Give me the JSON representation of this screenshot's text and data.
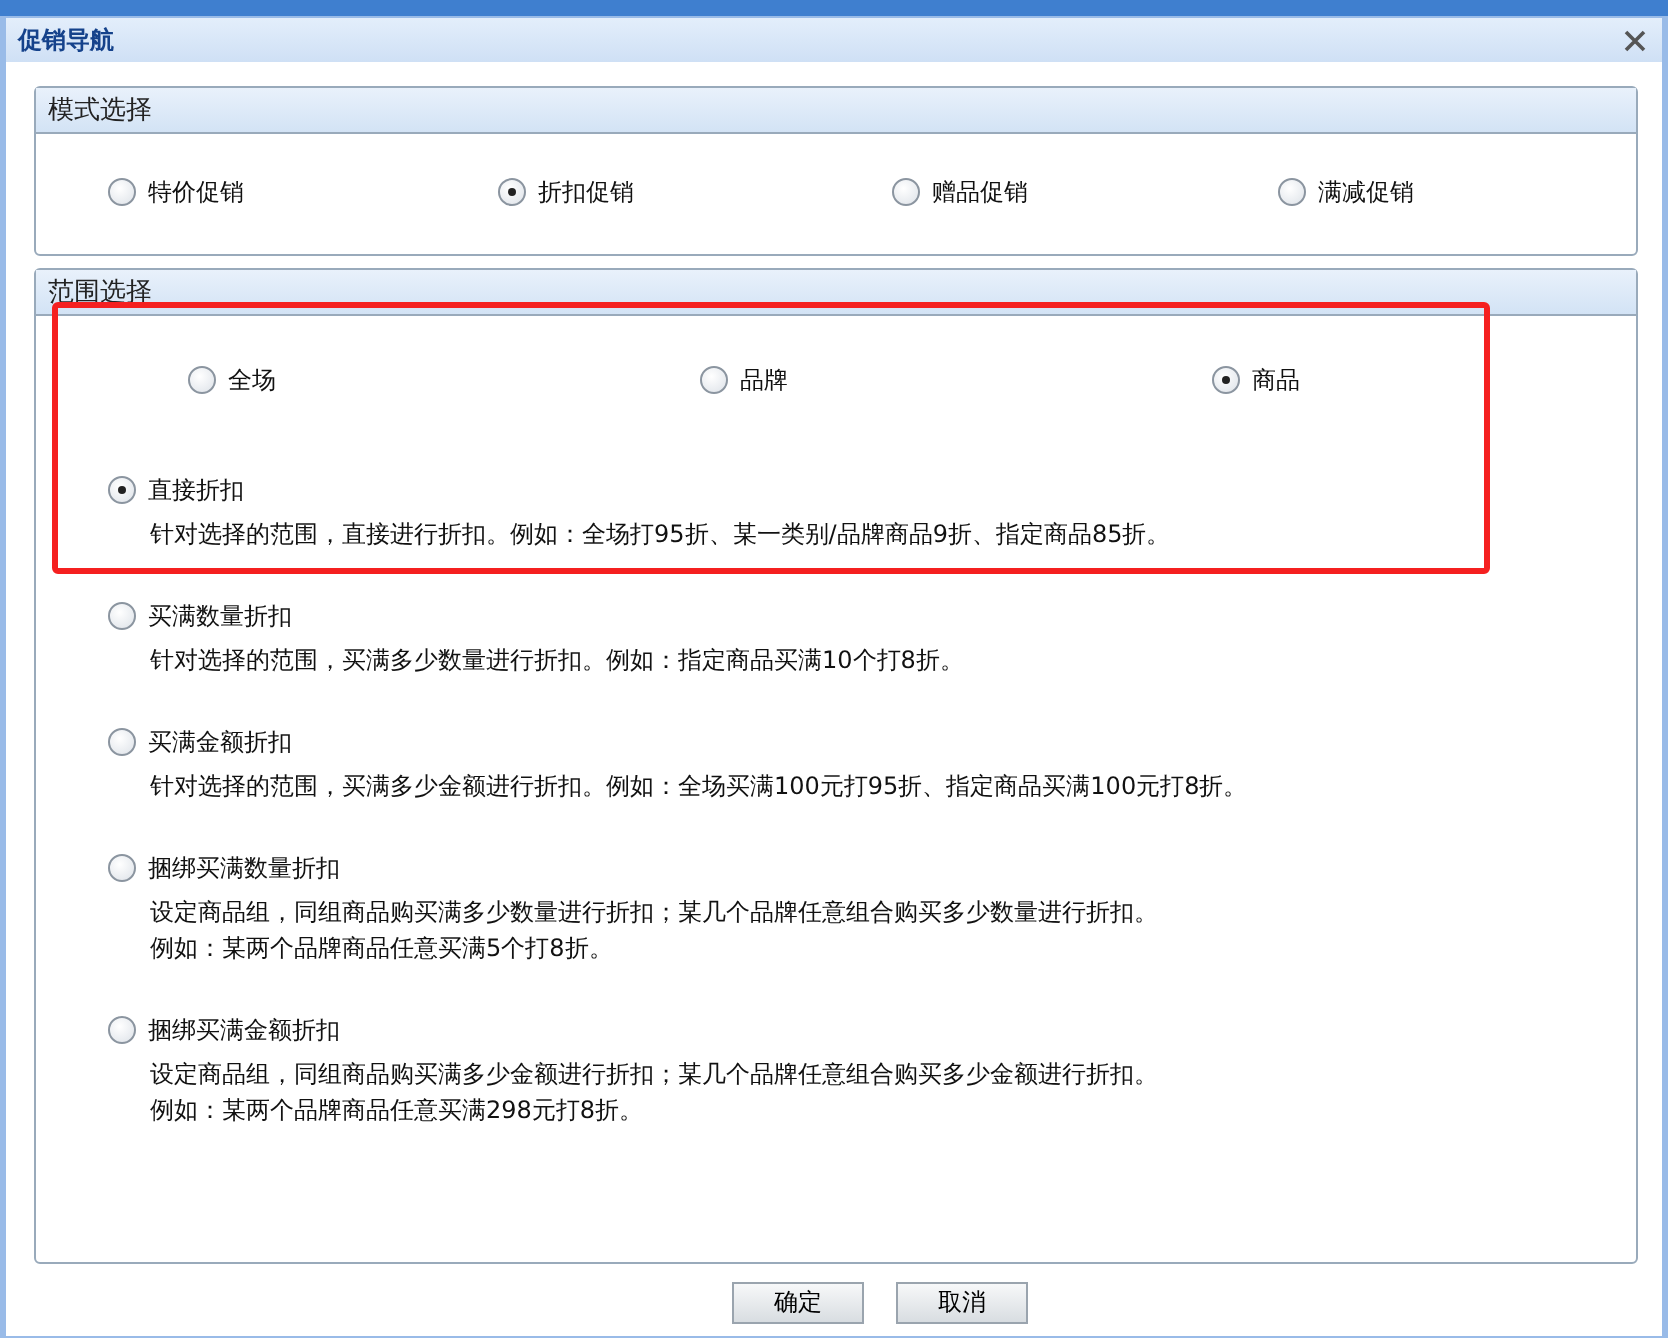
{
  "dialog": {
    "title": "促销导航"
  },
  "mode_panel": {
    "title": "模式选择",
    "options": [
      {
        "label": "特价促销",
        "selected": false
      },
      {
        "label": "折扣促销",
        "selected": true
      },
      {
        "label": "赠品促销",
        "selected": false
      },
      {
        "label": "满减促销",
        "selected": false
      }
    ]
  },
  "scope_panel": {
    "title": "范围选择",
    "scopes": [
      {
        "label": "全场",
        "selected": false
      },
      {
        "label": "品牌",
        "selected": false
      },
      {
        "label": "商品",
        "selected": true
      }
    ],
    "methods": [
      {
        "label": "直接折扣",
        "selected": true,
        "description": [
          "针对选择的范围，直接进行折扣。例如：全场打95折、某一类别/品牌商品9折、指定商品85折。"
        ]
      },
      {
        "label": "买满数量折扣",
        "selected": false,
        "description": [
          "针对选择的范围，买满多少数量进行折扣。例如：指定商品买满10个打8折。"
        ]
      },
      {
        "label": "买满金额折扣",
        "selected": false,
        "description": [
          "针对选择的范围，买满多少金额进行折扣。例如：全场买满100元打95折、指定商品买满100元打8折。"
        ]
      },
      {
        "label": "捆绑买满数量折扣",
        "selected": false,
        "description": [
          "设定商品组，同组商品购买满多少数量进行折扣；某几个品牌任意组合购买多少数量进行折扣。",
          "例如：某两个品牌商品任意买满5个打8折。"
        ]
      },
      {
        "label": "捆绑买满金额折扣",
        "selected": false,
        "description": [
          "设定商品组，同组商品购买满多少金额进行折扣；某几个品牌任意组合购买多少金额进行折扣。",
          "例如：某两个品牌商品任意买满298元打8折。"
        ]
      }
    ]
  },
  "buttons": [
    "确定",
    "取消"
  ]
}
